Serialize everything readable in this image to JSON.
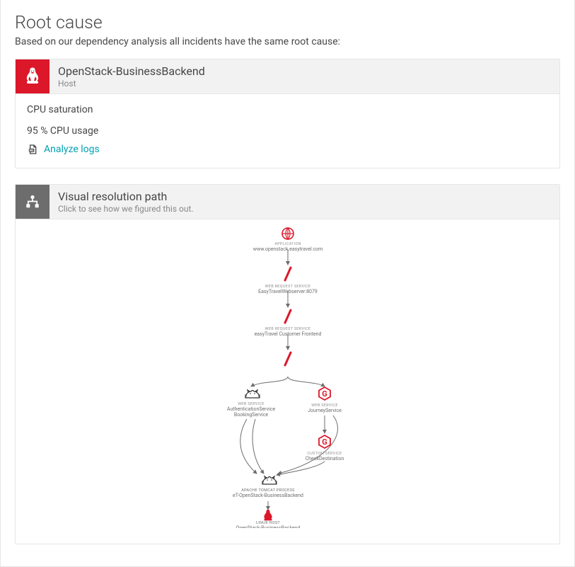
{
  "page": {
    "title": "Root cause",
    "subtitle": "Based on our dependency analysis all incidents have the same root cause:"
  },
  "rootCausePanel": {
    "entityName": "OpenStack-BusinessBackend",
    "entityType": "Host",
    "findingTitle": "CPU saturation",
    "findingValue": "95 % CPU usage",
    "analyzeLink": "Analyze logs"
  },
  "visualPanel": {
    "title": "Visual resolution path",
    "subtitle": "Click to see how we figured this out."
  },
  "graph": {
    "nodes": {
      "app": {
        "type": "APPLICATION",
        "name": "www.openstack.easytravel.com"
      },
      "webreq1": {
        "type": "WEB REQUEST SERVICE",
        "name": "EasyTravelWebserver:8079"
      },
      "webreq2": {
        "type": "WEB REQUEST SERVICE",
        "name": "easyTravel Customer Frontend"
      },
      "authBooking": {
        "type": "WEB SERVICE",
        "name1": "AuthenticationService",
        "name2": "BookingService"
      },
      "journey": {
        "type": "WEB SERVICE",
        "name": "JourneyService"
      },
      "checkDest": {
        "type": "CUSTOM SERVICE",
        "name": "CheckDestination"
      },
      "tomcat": {
        "type": "APACHE TOMCAT PROCESS",
        "name": "eT-OpenStack-BusinessBackend"
      },
      "host": {
        "type": "LINUX HOST",
        "name": "OpenStack-BusinessBackend"
      }
    }
  }
}
